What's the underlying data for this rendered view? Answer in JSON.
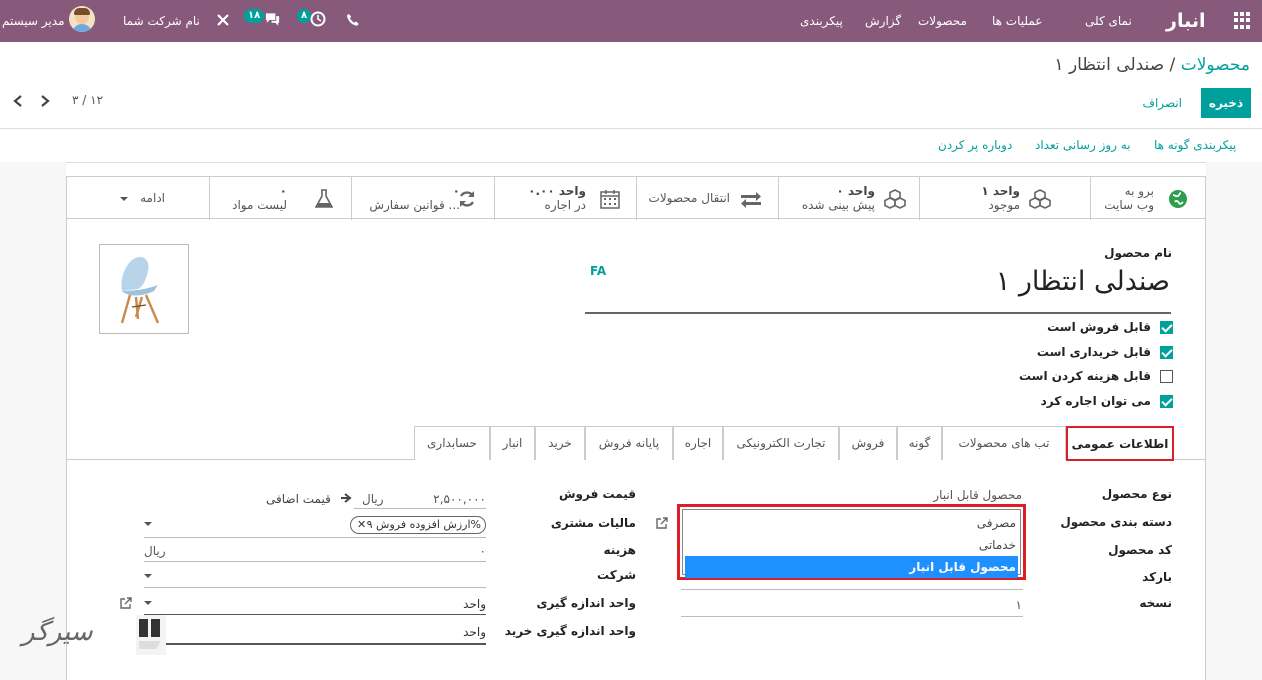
{
  "navbar": {
    "brand": "انبار",
    "menu": [
      "نمای کلی",
      "عملیات ها",
      "محصولات",
      "گزارش",
      "پیکربندی"
    ],
    "activity_count": "۸",
    "messages_count": "۱۸",
    "company": "نام شرکت شما",
    "user": "مدیر سیستم"
  },
  "breadcrumb": {
    "parent": "محصولات",
    "separator": "/",
    "current": "صندلی انتظار ۱"
  },
  "buttons": {
    "save": "ذخیره",
    "discard": "انصراف"
  },
  "pager": "۳ / ۱۲",
  "actions": [
    "پیکربندی گونه ها",
    "به روز رسانی تعداد",
    "دوباره پر کردن"
  ],
  "stats": {
    "website": {
      "line1": "برو به",
      "line2": "وب سایت"
    },
    "onhand": {
      "line1": "۱ واحد",
      "line2": "موجود"
    },
    "forecast": {
      "line1": "۰ واحد",
      "line2": "پیش بینی شده"
    },
    "moves": {
      "line1": "انتقال محصولات"
    },
    "rental": {
      "line1": "۰.۰۰ واحد",
      "line2": "در اجاره"
    },
    "reorder": {
      "line1": "۰",
      "line2": "قوانین سفارش ..."
    },
    "bom": {
      "line1": "۰",
      "line2": "لیست مواد"
    },
    "more": "ادامه"
  },
  "product": {
    "name_label": "نام محصول",
    "name": "صندلی انتظار ۱",
    "lang": "FA",
    "checkboxes": [
      {
        "label": "قابل فروش است",
        "checked": true
      },
      {
        "label": "قابل خریداری است",
        "checked": true
      },
      {
        "label": "قابل هزینه کردن است",
        "checked": false
      },
      {
        "label": "می توان اجاره کرد",
        "checked": true
      }
    ]
  },
  "tabs": [
    "اطلاعات عمومی",
    "تب های محصولات",
    "گونه",
    "فروش",
    "تجارت الکترونیکی",
    "اجاره",
    "پایانه فروش",
    "خرید",
    "انبار",
    "حسابداری"
  ],
  "form_right": {
    "labels": [
      "نوع محصول",
      "دسته بندی محصول",
      "کد محصول",
      "بارکد",
      "نسخه"
    ],
    "type_value": "محصول قابل انبار",
    "version_value": "۱",
    "dropdown_options": [
      "مصرفی",
      "خدماتی",
      "محصول قابل انبار"
    ]
  },
  "form_left": {
    "labels": [
      "قیمت فروش",
      "مالیات مشتری",
      "هزینه",
      "شرکت",
      "واحد اندازه گیری",
      "واحد اندازه گیری خرید"
    ],
    "sale_price": "۲,۵۰۰,۰۰۰",
    "currency": "ریال",
    "extra_price": "قیمت اضافی",
    "tax_tag": "ارزش افزوده فروش ۹%",
    "cost": "۰",
    "cost_currency": "ریال",
    "uom": "واحد",
    "purchase_uom": "واحد"
  },
  "watermark": "سیرگر"
}
